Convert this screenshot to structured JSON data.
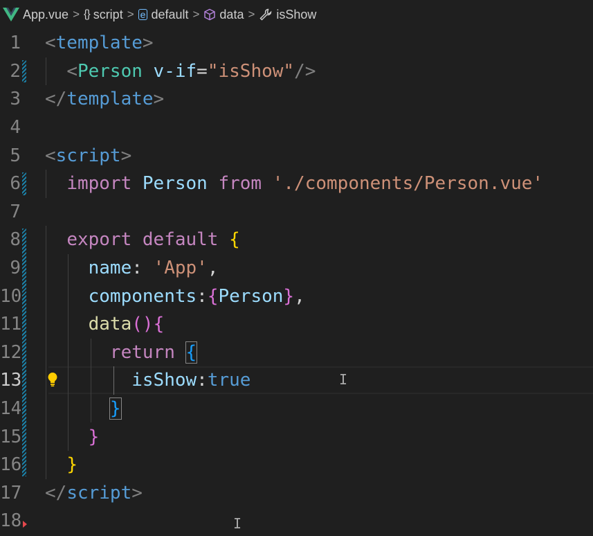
{
  "breadcrumbs": [
    {
      "icon": "vue-logo-icon",
      "label": "App.vue"
    },
    {
      "icon": "braces-icon",
      "label": "script"
    },
    {
      "icon": "field-icon",
      "label": "default"
    },
    {
      "icon": "cube-icon",
      "label": "data"
    },
    {
      "icon": "wrench-icon",
      "label": "isShow"
    }
  ],
  "breadcrumb_separator": ">",
  "editor": {
    "active_line": 13,
    "line_numbers": [
      "1",
      "2",
      "3",
      "4",
      "5",
      "6",
      "7",
      "8",
      "9",
      "10",
      "11",
      "12",
      "13",
      "14",
      "15",
      "16",
      "17",
      "18"
    ],
    "lines": [
      [
        [
          "<",
          "punc"
        ],
        [
          "template",
          "tag"
        ],
        [
          ">",
          "punc"
        ]
      ],
      [
        [
          "  ",
          ""
        ],
        [
          "<",
          "punc"
        ],
        [
          "Person",
          "comp"
        ],
        [
          " ",
          ""
        ],
        [
          "v-if",
          "attr"
        ],
        [
          "=",
          ""
        ],
        [
          "\"isShow\"",
          "str"
        ],
        [
          "/>",
          "punc"
        ]
      ],
      [
        [
          "</",
          "punc"
        ],
        [
          "template",
          "tag"
        ],
        [
          ">",
          "punc"
        ]
      ],
      [],
      [
        [
          "<",
          "punc"
        ],
        [
          "script",
          "tag"
        ],
        [
          ">",
          "punc"
        ]
      ],
      [
        [
          "  ",
          ""
        ],
        [
          "import",
          "kw"
        ],
        [
          " ",
          ""
        ],
        [
          "Person",
          "var"
        ],
        [
          " ",
          ""
        ],
        [
          "from",
          "kw"
        ],
        [
          " ",
          ""
        ],
        [
          "'./components/Person.vue'",
          "str"
        ]
      ],
      [],
      [
        [
          "  ",
          ""
        ],
        [
          "export",
          "kw"
        ],
        [
          " ",
          ""
        ],
        [
          "default",
          "kw"
        ],
        [
          " ",
          ""
        ],
        [
          "{",
          "b1"
        ]
      ],
      [
        [
          "    ",
          ""
        ],
        [
          "name",
          "var"
        ],
        [
          ": ",
          ""
        ],
        [
          "'App'",
          "str"
        ],
        [
          ",",
          ""
        ]
      ],
      [
        [
          "    ",
          ""
        ],
        [
          "components",
          "var"
        ],
        [
          ":",
          ""
        ],
        [
          "{",
          "b2"
        ],
        [
          "Person",
          "var"
        ],
        [
          "}",
          "b2"
        ],
        [
          ",",
          ""
        ]
      ],
      [
        [
          "    ",
          ""
        ],
        [
          "data",
          "fn"
        ],
        [
          "()",
          "b2"
        ],
        [
          "{",
          "b2"
        ]
      ],
      [
        [
          "      ",
          ""
        ],
        [
          "return",
          "kw"
        ],
        [
          " ",
          ""
        ],
        [
          "{",
          "b3box"
        ]
      ],
      [
        [
          "        ",
          ""
        ],
        [
          "isShow",
          "var"
        ],
        [
          ":",
          ""
        ],
        [
          "true",
          "const"
        ]
      ],
      [
        [
          "      ",
          ""
        ],
        [
          "}",
          "b3box"
        ]
      ],
      [
        [
          "    ",
          ""
        ],
        [
          "}",
          "b2"
        ]
      ],
      [
        [
          "  ",
          ""
        ],
        [
          "}",
          "b1"
        ]
      ],
      [
        [
          "</",
          "punc"
        ],
        [
          "script",
          "tag"
        ],
        [
          ">",
          "punc"
        ]
      ],
      []
    ]
  },
  "colors": {
    "background": "#1f1f1f",
    "tag": "#569cd6",
    "component": "#4ec9b0",
    "string": "#ce9178",
    "keyword": "#c586c0",
    "variable": "#9cdcfe",
    "function": "#dcdcaa",
    "bracket_gold": "#ffd700",
    "bracket_orchid": "#da70d6",
    "bracket_blue": "#179fff",
    "modified_bar": "#1b81a8"
  }
}
